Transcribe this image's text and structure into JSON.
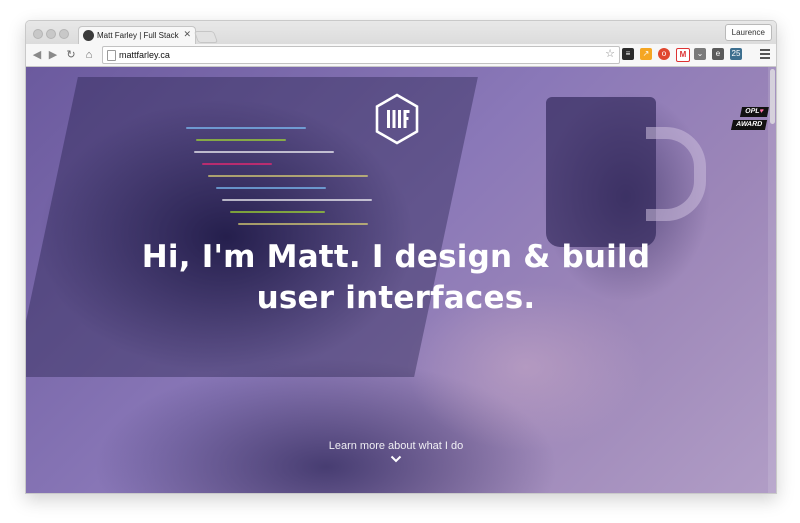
{
  "browser": {
    "tab_title": "Matt Farley | Full Stack Desi",
    "tab_close": "✕",
    "profile_name": "Laurence",
    "url": "mattfarley.ca",
    "ext_badge": "25"
  },
  "hero": {
    "award_line1": "OPL",
    "award_heart": "♥",
    "award_line2": "AWARD",
    "headline_line1": "Hi, I'm Matt. I design & build",
    "headline_line2": "user interfaces.",
    "learn_more": "Learn more about what I do"
  },
  "colors": {
    "overlay": "#7b68b0",
    "text": "#ffffff"
  }
}
